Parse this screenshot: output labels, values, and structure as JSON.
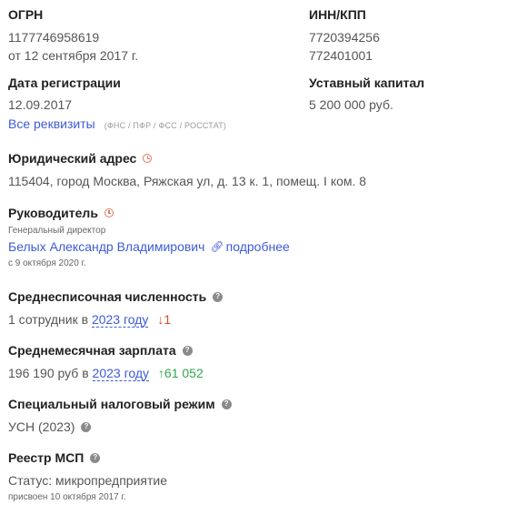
{
  "ogrn": {
    "label": "ОГРН",
    "value": "1177746958619",
    "date": "от 12 сентября 2017 г."
  },
  "inn_kpp": {
    "label": "ИНН/КПП",
    "inn": "7720394256",
    "kpp": "772401001"
  },
  "registration": {
    "label": "Дата регистрации",
    "value": "12.09.2017"
  },
  "capital": {
    "label": "Уставный капитал",
    "value": "5 200 000 руб."
  },
  "requisites": {
    "link": "Все реквизиты",
    "note": "(ФНС / ПФР / ФСС / РОССТАТ)"
  },
  "address": {
    "label": "Юридический адрес",
    "value": "115404, город Москва, Ряжская ул, д. 13 к. 1, помещ. I ком. 8",
    "icon": "clock-icon"
  },
  "director": {
    "label": "Руководитель",
    "position": "Генеральный директор",
    "name": "Белых Александр Владимирович",
    "more": "подробнее",
    "since": "с 9 октября 2020 г.",
    "icon": "clock-icon"
  },
  "headcount": {
    "label": "Среднесписочная численность",
    "value_prefix": "1 сотрудник в",
    "year": "2023 году",
    "change": "↓1",
    "change_color": "#d64b2b"
  },
  "salary": {
    "label": "Среднемесячная зарплата",
    "value_prefix": "196 190 руб в",
    "year": "2023 году",
    "change": "↑61 052",
    "change_color": "#2fa84f"
  },
  "tax": {
    "label": "Специальный налоговый режим",
    "value": "УСН (2023)"
  },
  "msp": {
    "label": "Реестр МСП",
    "status": "Статус: микропредприятие",
    "assigned": "присвоен 10 октября 2017 г."
  },
  "colors": {
    "link": "#3d5bd9",
    "clock": "#e07a5f",
    "help_icon": "#8a8a8a"
  }
}
